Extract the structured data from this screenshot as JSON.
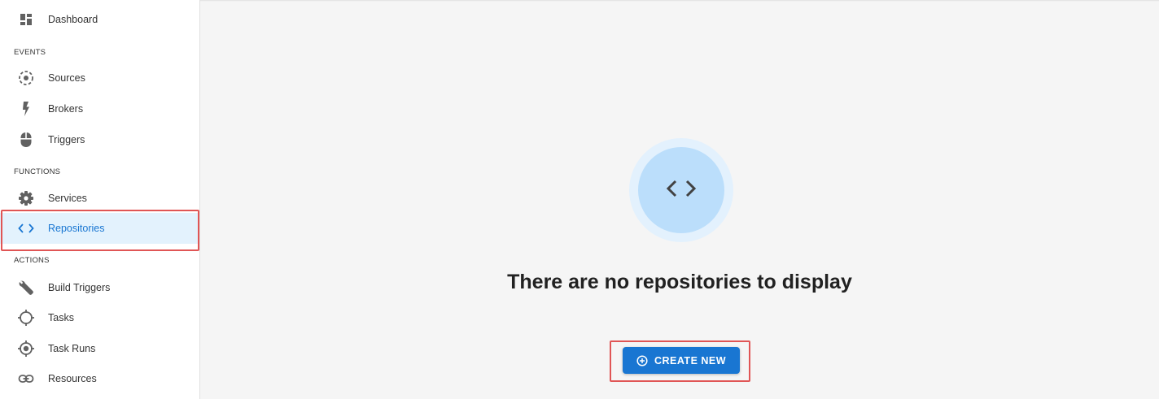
{
  "sidebar": {
    "sections": {
      "events": "EVENTS",
      "functions": "FUNCTIONS",
      "actions": "ACTIONS"
    },
    "items": {
      "dashboard": {
        "label": "Dashboard",
        "icon": "dashboard-icon"
      },
      "sources": {
        "label": "Sources",
        "icon": "sources-icon"
      },
      "brokers": {
        "label": "Brokers",
        "icon": "lightning-icon"
      },
      "triggers": {
        "label": "Triggers",
        "icon": "mouse-icon"
      },
      "services": {
        "label": "Services",
        "icon": "gear-icon"
      },
      "repositories": {
        "label": "Repositories",
        "icon": "code-icon",
        "active": true
      },
      "build_triggers": {
        "label": "Build Triggers",
        "icon": "wrench-icon"
      },
      "tasks": {
        "label": "Tasks",
        "icon": "crosshair-icon"
      },
      "task_runs": {
        "label": "Task Runs",
        "icon": "target-icon"
      },
      "resources": {
        "label": "Resources",
        "icon": "link-icon"
      }
    }
  },
  "main": {
    "empty_state": {
      "icon": "code-icon",
      "title": "There are no repositories to display",
      "button_label": "CREATE NEW",
      "button_icon": "add-circle-icon"
    }
  },
  "colors": {
    "accent": "#1976d2",
    "active_bg": "#e3f2fd",
    "highlight": "#e05555",
    "icon_gray": "#616161"
  }
}
